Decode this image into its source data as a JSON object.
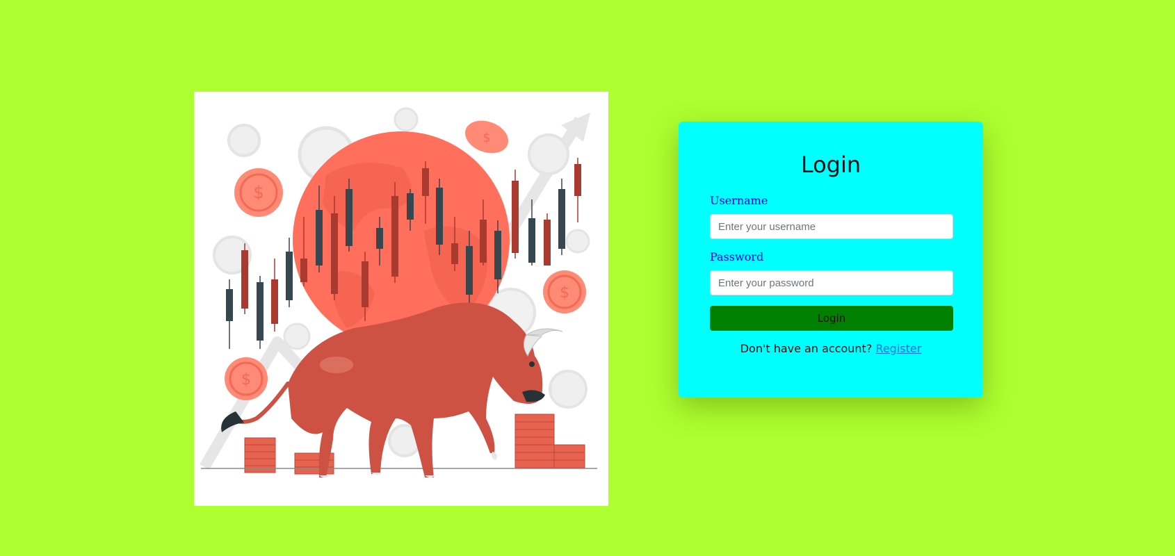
{
  "hero": {
    "image_name": "bull-market-illustration",
    "colors": {
      "sun": "#ff6f5b",
      "bull": "#cd5243",
      "candle_dark": "#37474f",
      "candle_red": "#a93a2f",
      "coin": "#ff8a75",
      "faint": "#ececec"
    }
  },
  "login": {
    "title": "Login",
    "username_label": "Username",
    "username_placeholder": "Enter your username",
    "username_value": "",
    "password_label": "Password",
    "password_placeholder": "Enter your password",
    "password_value": "",
    "submit_label": "Login",
    "register_prompt": "Don't have an account?",
    "register_link": "Register"
  },
  "colors": {
    "page_background": "#adff2f",
    "card_background": "#00ffff",
    "label_color": "#0000ff",
    "button_background": "#008000",
    "link_color": "#1a73e8"
  }
}
